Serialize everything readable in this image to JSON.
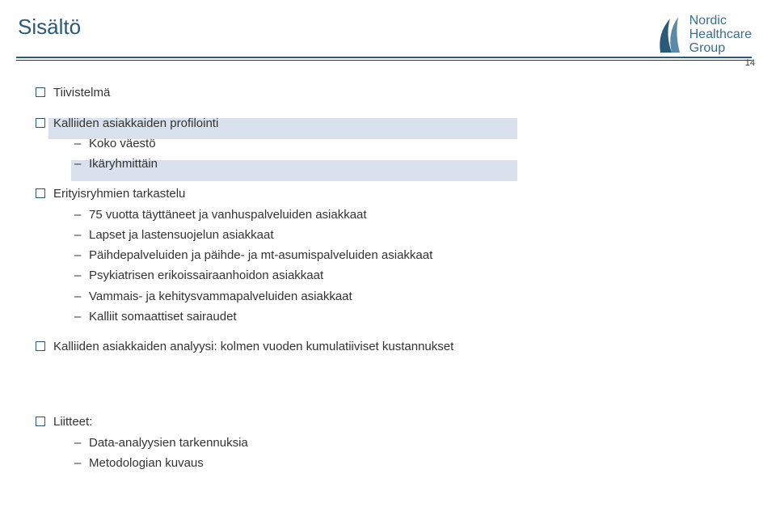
{
  "page": {
    "title": "Sisältö",
    "number": "14"
  },
  "logo": {
    "line1": "Nordic",
    "line2": "Healthcare",
    "line3": "Group"
  },
  "sections": {
    "s1": "Tiivistelmä",
    "s2": "Kalliiden asiakkaiden profilointi",
    "s2a": "Koko väestö",
    "s2b": "Ikäryhmittäin",
    "s3": "Erityisryhmien tarkastelu",
    "s3a": "75 vuotta täyttäneet ja vanhuspalveluiden asiakkaat",
    "s3b": "Lapset ja lastensuojelun asiakkaat",
    "s3c": "Päihdepalveluiden ja päihde- ja mt-asumispalveluiden asiakkaat",
    "s3d": "Psykiatrisen erikoissairaanhoidon asiakkaat",
    "s3e": "Vammais- ja kehitysvammapalveluiden asiakkaat",
    "s3f": "Kalliit somaattiset sairaudet",
    "s4": "Kalliiden asiakkaiden analyysi: kolmen vuoden kumulatiiviset kustannukset",
    "s5": "Liitteet:",
    "s5a": "Data-analyysien tarkennuksia",
    "s5b": "Metodologian kuvaus"
  }
}
